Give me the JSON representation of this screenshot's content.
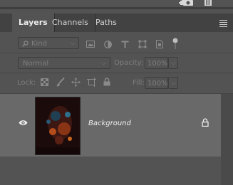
{
  "tabs": [
    {
      "label": "Layers"
    },
    {
      "label": "Channels"
    },
    {
      "label": "Paths"
    }
  ],
  "filter": {
    "placeholder": "Kind"
  },
  "blend": {
    "mode": "Normal"
  },
  "opacity": {
    "label": "Opacity:",
    "value": "100%"
  },
  "lock": {
    "label": "Lock:"
  },
  "fill": {
    "label": "Fill:",
    "value": "100%"
  },
  "layer": {
    "name": "Background"
  },
  "icons": [
    "new-layer-icon",
    "camera-icon",
    "trash-icon",
    "panel-menu-icon",
    "search-icon",
    "image-filter-icon",
    "adjustment-filter-icon",
    "type-filter-icon",
    "shape-filter-icon",
    "smart-object-filter-icon",
    "filter-toggle-icon",
    "lock-pixels-icon",
    "lock-brush-icon",
    "lock-position-icon",
    "lock-artboard-icon",
    "lock-all-icon",
    "eye-icon",
    "lock-icon"
  ]
}
